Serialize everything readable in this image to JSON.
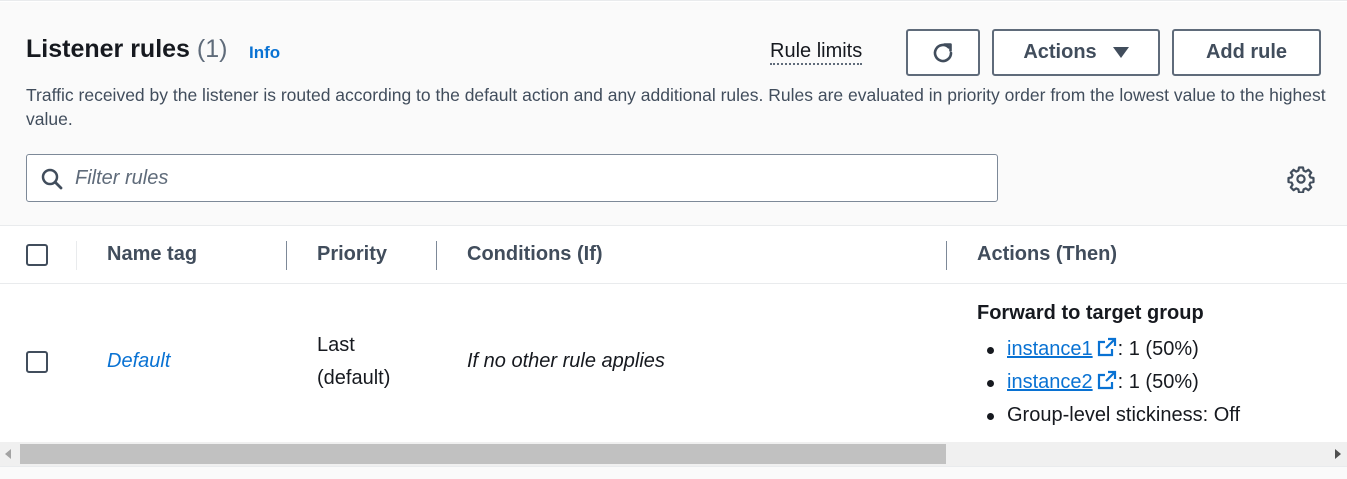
{
  "header": {
    "title": "Listener rules",
    "count": "(1)",
    "info_label": "Info",
    "rule_limits_label": "Rule limits",
    "actions_label": "Actions",
    "add_rule_label": "Add rule",
    "description": "Traffic received by the listener is routed according to the default action and any additional rules. Rules are evaluated in priority order from the lowest value to the highest value."
  },
  "filter": {
    "placeholder": "Filter rules",
    "value": ""
  },
  "table": {
    "columns": [
      "Name tag",
      "Priority",
      "Conditions (If)",
      "Actions (Then)"
    ],
    "rows": [
      {
        "name_tag": "Default",
        "priority_line1": "Last",
        "priority_line2": "(default)",
        "condition": "If no other rule applies",
        "action_title": "Forward to target group",
        "targets": [
          {
            "name": "instance1",
            "weight": ": 1 (50%)"
          },
          {
            "name": "instance2",
            "weight": ": 1 (50%)"
          }
        ],
        "stickiness": "Group-level stickiness: Off"
      }
    ]
  },
  "colors": {
    "link": "#0972d3",
    "text": "#16191f",
    "muted": "#414d5c",
    "border": "#7d8998"
  },
  "icons": [
    "refresh-icon",
    "caret-down-icon",
    "search-icon",
    "gear-icon",
    "external-link-icon"
  ]
}
